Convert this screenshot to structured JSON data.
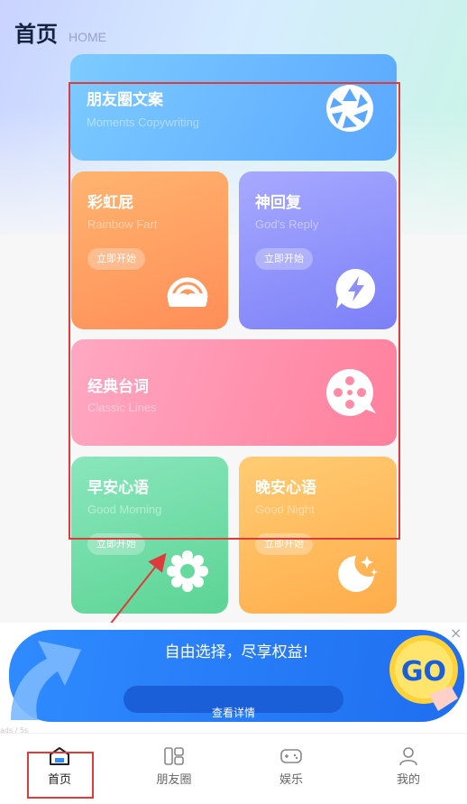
{
  "header": {
    "title": "首页",
    "subtitle": "HOME"
  },
  "cards": {
    "moments": {
      "title": "朋友圈文案",
      "subtitle": "Moments Copywriting"
    },
    "rainbow": {
      "title": "彩虹屁",
      "subtitle": "Rainbow Fart",
      "button": "立即开始"
    },
    "god": {
      "title": "神回复",
      "subtitle": "God's Reply",
      "button": "立即开始"
    },
    "classic": {
      "title": "经典台词",
      "subtitle": "Classic Lines"
    },
    "morning": {
      "title": "早安心语",
      "subtitle": "Good Morning",
      "button": "立即开始"
    },
    "night": {
      "title": "晚安心语",
      "subtitle": "Good Night",
      "button": "立即开始"
    }
  },
  "banner": {
    "text": "自由选择，尽享权益!",
    "button": "查看详情",
    "badge": "GO",
    "close": "×",
    "tag": "ads / 5s"
  },
  "tabbar": {
    "items": [
      {
        "label": "首页",
        "icon": "home-icon",
        "active": true
      },
      {
        "label": "朋友圈",
        "icon": "moments-icon",
        "active": false
      },
      {
        "label": "娱乐",
        "icon": "gamepad-icon",
        "active": false
      },
      {
        "label": "我的",
        "icon": "person-icon",
        "active": false
      }
    ]
  },
  "colors": {
    "annotation": "#e03b3b",
    "accent": "#2f8bff"
  }
}
